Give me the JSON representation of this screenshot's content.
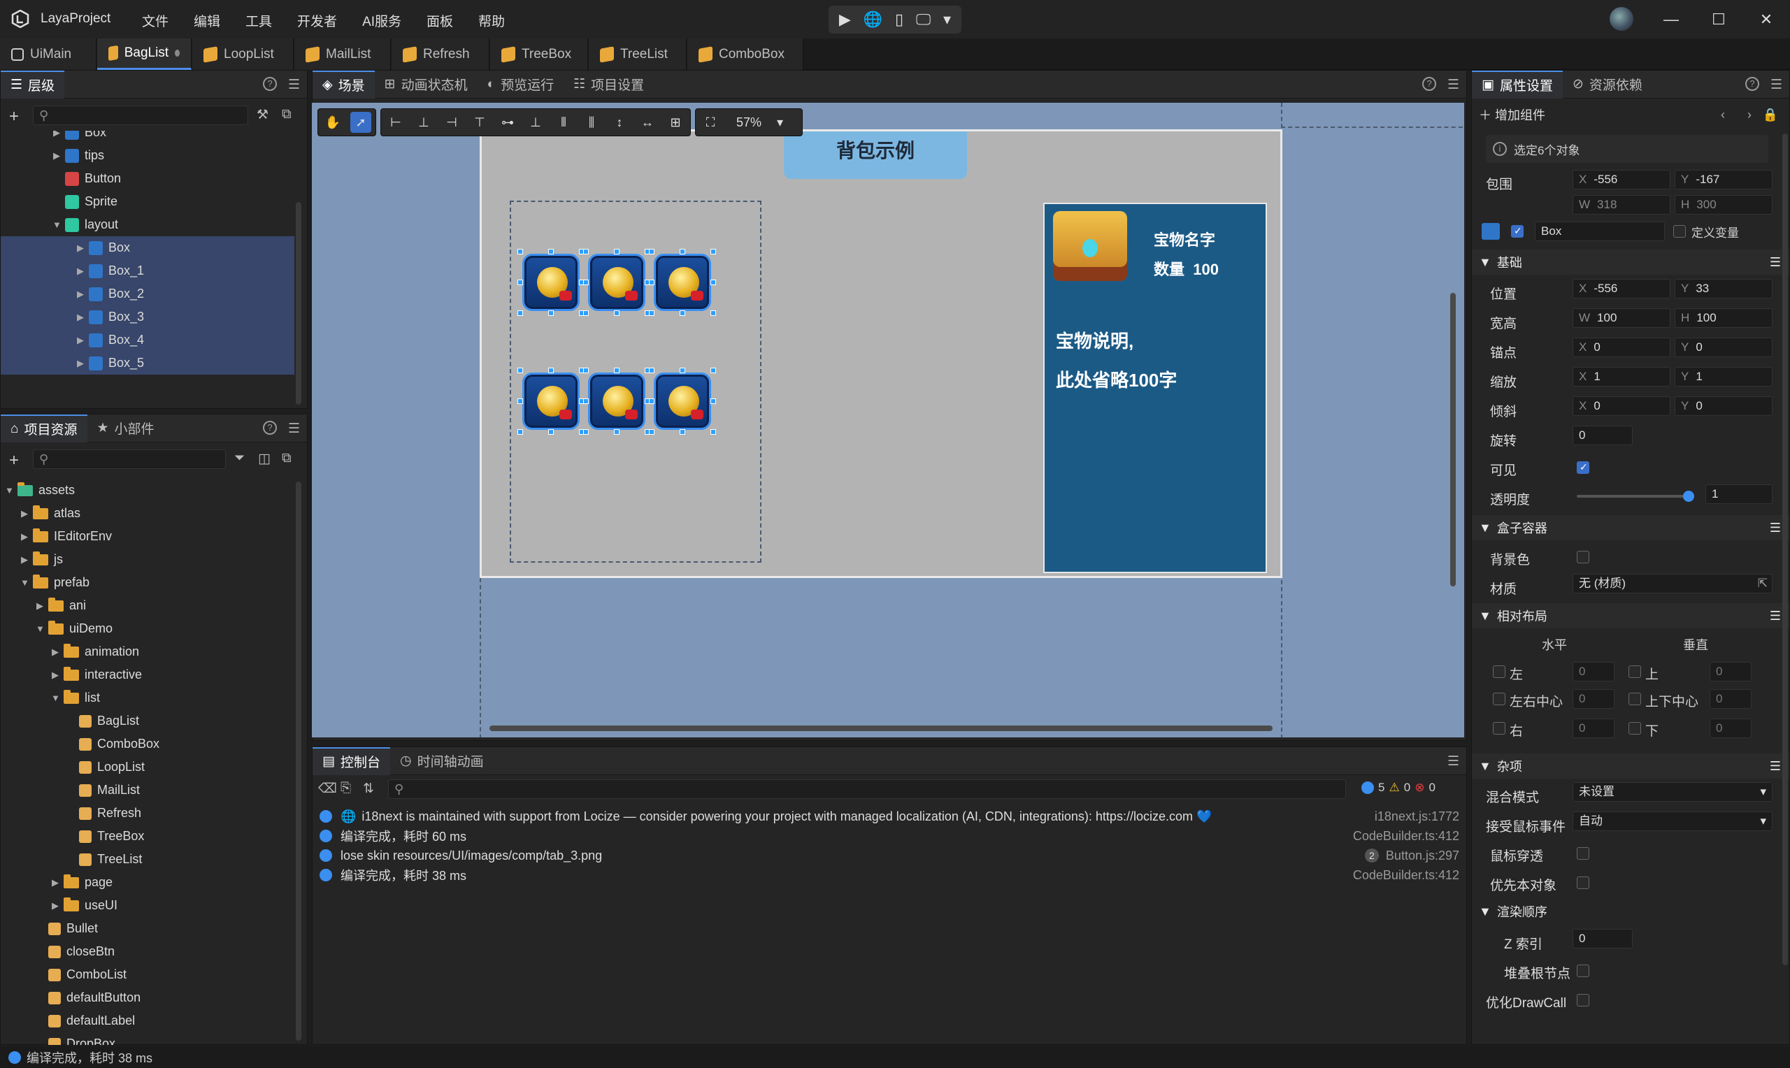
{
  "app": {
    "title": "LayaProject",
    "menus": [
      "文件",
      "编辑",
      "工具",
      "开发者",
      "AI服务",
      "面板",
      "帮助"
    ]
  },
  "run_buttons": [
    "▶",
    "🌐",
    "▯",
    "🖵",
    "▾"
  ],
  "window_buttons": [
    "—",
    "☐",
    "✕"
  ],
  "editor_tabs": [
    {
      "label": "UiMain",
      "active": false
    },
    {
      "label": "BagList",
      "active": true
    },
    {
      "label": "LoopList",
      "active": false
    },
    {
      "label": "MailList",
      "active": false
    },
    {
      "label": "Refresh",
      "active": false
    },
    {
      "label": "TreeBox",
      "active": false
    },
    {
      "label": "TreeList",
      "active": false
    },
    {
      "label": "ComboBox",
      "active": false
    }
  ],
  "hierarchy": {
    "title": "层级",
    "search_placeholder": "",
    "items": [
      {
        "label": "Box",
        "expandable": true,
        "selected": false,
        "depth": 2,
        "icon": "box"
      },
      {
        "label": "tips",
        "expandable": true,
        "selected": false,
        "depth": 2,
        "icon": "box"
      },
      {
        "label": "Button",
        "expandable": false,
        "selected": false,
        "depth": 2,
        "icon": "button"
      },
      {
        "label": "Sprite",
        "expandable": false,
        "selected": false,
        "depth": 2,
        "icon": "sprite"
      },
      {
        "label": "layout",
        "expandable": true,
        "expanded": true,
        "selected": false,
        "depth": 2,
        "icon": "sprite"
      },
      {
        "label": "Box",
        "expandable": true,
        "selected": true,
        "depth": 3,
        "icon": "box"
      },
      {
        "label": "Box_1",
        "expandable": true,
        "selected": true,
        "depth": 3,
        "icon": "box"
      },
      {
        "label": "Box_2",
        "expandable": true,
        "selected": true,
        "depth": 3,
        "icon": "box"
      },
      {
        "label": "Box_3",
        "expandable": true,
        "selected": true,
        "depth": 3,
        "icon": "box"
      },
      {
        "label": "Box_4",
        "expandable": true,
        "selected": true,
        "depth": 3,
        "icon": "box"
      },
      {
        "label": "Box_5",
        "expandable": true,
        "selected": true,
        "depth": 3,
        "icon": "box"
      }
    ]
  },
  "assets": {
    "tabs": [
      "项目资源",
      "小部件"
    ],
    "items": [
      {
        "label": "assets",
        "type": "root",
        "depth": 0,
        "expanded": true
      },
      {
        "label": "atlas",
        "type": "folder",
        "depth": 1
      },
      {
        "label": "IEditorEnv",
        "type": "folder",
        "depth": 1
      },
      {
        "label": "js",
        "type": "folder",
        "depth": 1
      },
      {
        "label": "prefab",
        "type": "folder",
        "depth": 1,
        "expanded": true
      },
      {
        "label": "ani",
        "type": "folder",
        "depth": 2
      },
      {
        "label": "uiDemo",
        "type": "folder",
        "depth": 2,
        "expanded": true
      },
      {
        "label": "animation",
        "type": "folder",
        "depth": 3
      },
      {
        "label": "interactive",
        "type": "folder",
        "depth": 3
      },
      {
        "label": "list",
        "type": "folder",
        "depth": 3,
        "expanded": true
      },
      {
        "label": "BagList",
        "type": "file",
        "depth": 4
      },
      {
        "label": "ComboBox",
        "type": "file",
        "depth": 4
      },
      {
        "label": "LoopList",
        "type": "file",
        "depth": 4
      },
      {
        "label": "MailList",
        "type": "file",
        "depth": 4
      },
      {
        "label": "Refresh",
        "type": "file",
        "depth": 4
      },
      {
        "label": "TreeBox",
        "type": "file",
        "depth": 4
      },
      {
        "label": "TreeList",
        "type": "file",
        "depth": 4
      },
      {
        "label": "page",
        "type": "folder",
        "depth": 3
      },
      {
        "label": "useUI",
        "type": "folder",
        "depth": 3
      },
      {
        "label": "Bullet",
        "type": "file",
        "depth": 2
      },
      {
        "label": "closeBtn",
        "type": "file",
        "depth": 2
      },
      {
        "label": "ComboList",
        "type": "file",
        "depth": 2
      },
      {
        "label": "defaultButton",
        "type": "file",
        "depth": 2
      },
      {
        "label": "defaultLabel",
        "type": "file",
        "depth": 2
      },
      {
        "label": "DropBox",
        "type": "file",
        "depth": 2
      }
    ]
  },
  "scene_tabs": [
    "场景",
    "动画状态机",
    "预览运行",
    "项目设置"
  ],
  "zoom": "57%",
  "stage": {
    "title": "背包示例",
    "card_name": "宝物名字",
    "card_count": "数量  100",
    "card_desc1": "宝物说明,",
    "card_desc2": "此处省略100字"
  },
  "console": {
    "tabs": [
      "控制台",
      "时间轴动画"
    ],
    "counts": {
      "info": "5",
      "warn": "0",
      "error": "0"
    },
    "lines": [
      {
        "text": "i18next is maintained with support from Locize — consider powering your project with managed localization (AI, CDN, integrations): https://locize.com 💙",
        "source": "i18next.js:1772",
        "badge": ""
      },
      {
        "text": "编译完成，耗时 60 ms",
        "source": "CodeBuilder.ts:412",
        "badge": ""
      },
      {
        "text": "lose skin resources/UI/images/comp/tab_3.png",
        "source": "Button.js:297",
        "badge": "2"
      },
      {
        "text": "编译完成，耗时 38 ms",
        "source": "CodeBuilder.ts:412",
        "badge": ""
      }
    ]
  },
  "props": {
    "tabs": [
      "属性设置",
      "资源依赖"
    ],
    "add_component": "增加组件",
    "selected_info": "选定6个对象",
    "bounds": {
      "label": "包围",
      "x": "-556",
      "y": "-167",
      "w": "318",
      "h": "300"
    },
    "node_name": "Box",
    "define_var": "定义变量",
    "sections": {
      "basic": "基础",
      "box": "盒子容器",
      "relative": "相对布局",
      "misc": "杂项",
      "render": "渲染顺序"
    },
    "position": {
      "label": "位置",
      "x": "-556",
      "y": "33"
    },
    "size": {
      "label": "宽高",
      "w": "100",
      "h": "100"
    },
    "anchor": {
      "label": "锚点",
      "x": "0",
      "y": "0"
    },
    "scale": {
      "label": "缩放",
      "x": "1",
      "y": "1"
    },
    "skew": {
      "label": "倾斜",
      "x": "0",
      "y": "0"
    },
    "rotation": {
      "label": "旋转",
      "value": "0"
    },
    "visible": {
      "label": "可见",
      "checked": true
    },
    "alpha": {
      "label": "透明度",
      "value": "1",
      "level": 1.0
    },
    "bgcolor": {
      "label": "背景色"
    },
    "material": {
      "label": "材质",
      "value": "无 (材质)"
    },
    "layout": {
      "horizontal": "水平",
      "vertical": "垂直",
      "left": "左",
      "hcenter": "左右中心",
      "right": "右",
      "top": "上",
      "vcenter": "上下中心",
      "bottom": "下",
      "zero": "0"
    },
    "blend": {
      "label": "混合模式",
      "value": "未设置"
    },
    "mouse": {
      "label": "接受鼠标事件",
      "value": "自动"
    },
    "mouse_through": {
      "label": "鼠标穿透"
    },
    "priority": {
      "label": "优先本对象"
    },
    "zindex": {
      "label": "Z 索引",
      "value": "0"
    },
    "stack_root": {
      "label": "堆叠根节点"
    },
    "drawcall": {
      "label": "优化DrawCall"
    }
  },
  "status": "编译完成，耗时 38 ms",
  "colors": {
    "accent": "#4d8fe8",
    "selection": "#37466a",
    "canvas": "#7e97b8"
  }
}
